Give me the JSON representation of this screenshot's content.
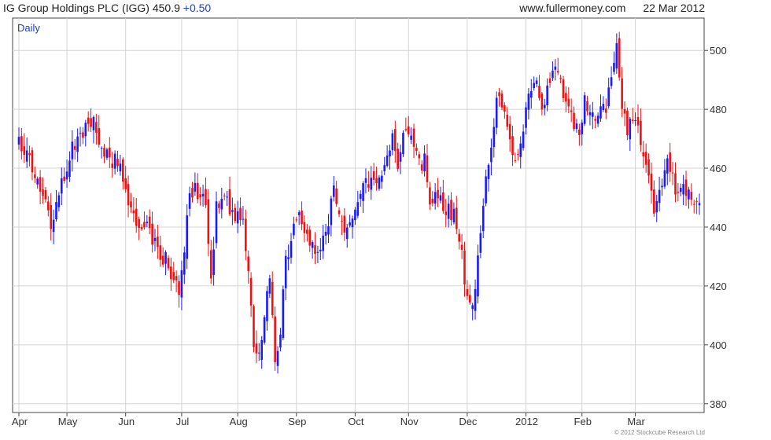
{
  "header": {
    "title": "IG Group Holdings PLC (IGG)",
    "price": "450.9",
    "change": "+0.50",
    "site": "www.fullermoney.com",
    "date": "22 Mar 2012"
  },
  "footer": {
    "copyright": "© 2012 Stockcube Research Ltd"
  },
  "colors": {
    "up": "#1a1aff",
    "down": "#ee1111",
    "grid": "#d4d4d4",
    "axis": "#444444"
  },
  "chart_data": {
    "type": "candlestick",
    "period_label": "Daily",
    "ylim": [
      377,
      511
    ],
    "y_ticks": [
      380,
      400,
      420,
      440,
      460,
      480,
      500
    ],
    "x_tick_labels": [
      "Apr",
      "May",
      "Jun",
      "Jul",
      "Aug",
      "Sep",
      "Oct",
      "Nov",
      "Dec",
      "2012",
      "Feb",
      "Mar"
    ],
    "axis_side": "right",
    "grid": true,
    "sessions": 256,
    "month_start_index": [
      0,
      18,
      40,
      61,
      82,
      104,
      126,
      146,
      168,
      190,
      211,
      231
    ],
    "close_path": [
      [
        0,
        469
      ],
      [
        4,
        462
      ],
      [
        8,
        454
      ],
      [
        12,
        442
      ],
      [
        16,
        455
      ],
      [
        20,
        467
      ],
      [
        24,
        473
      ],
      [
        28,
        475
      ],
      [
        32,
        464
      ],
      [
        36,
        462
      ],
      [
        38,
        459
      ],
      [
        40,
        450
      ],
      [
        44,
        442
      ],
      [
        48,
        440
      ],
      [
        52,
        433
      ],
      [
        56,
        427
      ],
      [
        58,
        421
      ],
      [
        60,
        418
      ],
      [
        62,
        434
      ],
      [
        64,
        451
      ],
      [
        66,
        452
      ],
      [
        70,
        449
      ],
      [
        72,
        420
      ],
      [
        74,
        447
      ],
      [
        76,
        451
      ],
      [
        80,
        445
      ],
      [
        84,
        441
      ],
      [
        86,
        423
      ],
      [
        88,
        402
      ],
      [
        90,
        396
      ],
      [
        92,
        409
      ],
      [
        94,
        424
      ],
      [
        96,
        396
      ],
      [
        98,
        404
      ],
      [
        100,
        428
      ],
      [
        104,
        445
      ],
      [
        108,
        437
      ],
      [
        112,
        430
      ],
      [
        116,
        441
      ],
      [
        118,
        453
      ],
      [
        122,
        439
      ],
      [
        126,
        445
      ],
      [
        130,
        457
      ],
      [
        134,
        453
      ],
      [
        136,
        460
      ],
      [
        140,
        471
      ],
      [
        142,
        458
      ],
      [
        144,
        469
      ],
      [
        146,
        474
      ],
      [
        148,
        466
      ],
      [
        150,
        461
      ],
      [
        152,
        462
      ],
      [
        154,
        450
      ],
      [
        156,
        449
      ],
      [
        160,
        447
      ],
      [
        164,
        442
      ],
      [
        166,
        430
      ],
      [
        168,
        415
      ],
      [
        170,
        413
      ],
      [
        172,
        429
      ],
      [
        174,
        447
      ],
      [
        176,
        462
      ],
      [
        178,
        476
      ],
      [
        180,
        486
      ],
      [
        182,
        478
      ],
      [
        184,
        467
      ],
      [
        186,
        460
      ],
      [
        188,
        468
      ],
      [
        190,
        482
      ],
      [
        194,
        490
      ],
      [
        196,
        478
      ],
      [
        200,
        496
      ],
      [
        204,
        486
      ],
      [
        208,
        476
      ],
      [
        210,
        472
      ],
      [
        212,
        483
      ],
      [
        214,
        476
      ],
      [
        218,
        482
      ],
      [
        220,
        480
      ],
      [
        222,
        493
      ],
      [
        224,
        500
      ],
      [
        226,
        480
      ],
      [
        228,
        474
      ],
      [
        230,
        477
      ],
      [
        232,
        473
      ],
      [
        234,
        465
      ],
      [
        236,
        456
      ],
      [
        238,
        444
      ],
      [
        240,
        451
      ],
      [
        242,
        462
      ],
      [
        244,
        460
      ],
      [
        246,
        452
      ],
      [
        248,
        453
      ],
      [
        250,
        452
      ],
      [
        252,
        450
      ],
      [
        255,
        450.9
      ]
    ]
  }
}
